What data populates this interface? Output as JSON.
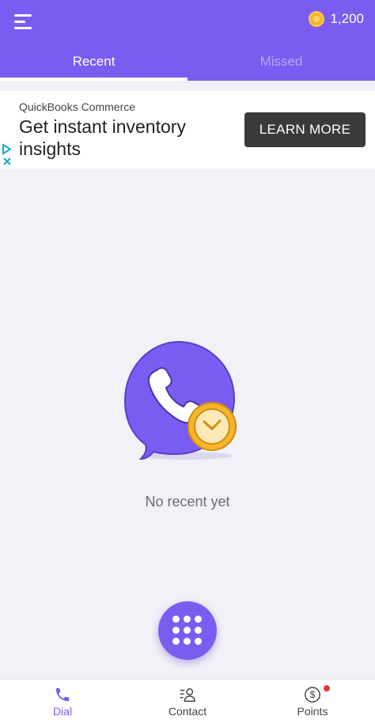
{
  "header": {
    "coin_balance": "1,200"
  },
  "tabs": [
    {
      "label": "Recent",
      "active": true
    },
    {
      "label": "Missed",
      "active": false
    }
  ],
  "ad": {
    "advertiser": "QuickBooks Commerce",
    "headline": "Get instant inventory insights",
    "cta": "LEARN MORE"
  },
  "empty_state": {
    "message": "No recent yet"
  },
  "bottom_nav": {
    "items": [
      {
        "label": "Dial",
        "icon": "phone-icon",
        "active": true
      },
      {
        "label": "Contact",
        "icon": "contact-icon",
        "active": false
      },
      {
        "label": "Points",
        "icon": "dollar-icon",
        "active": false,
        "badge": true
      }
    ]
  },
  "colors": {
    "primary": "#7b5cf0",
    "background": "#f2f1f8",
    "coin": "#f6b52b",
    "badge": "#e53935"
  }
}
